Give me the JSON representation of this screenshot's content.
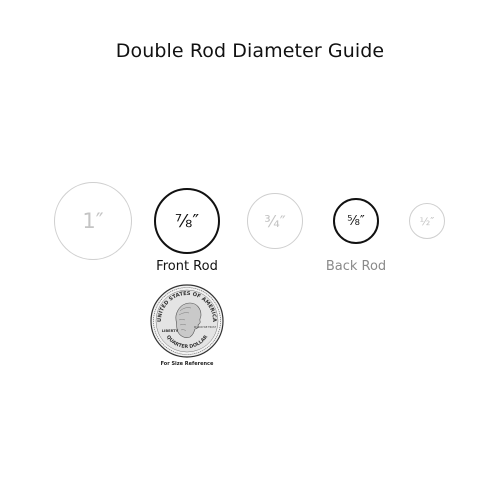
{
  "title": "Double Rod Diameter Guide",
  "rods": [
    {
      "size": "1″",
      "diameter_in": 1.0,
      "highlighted": false
    },
    {
      "size": "⅞″",
      "diameter_in": 0.875,
      "highlighted": true
    },
    {
      "size": "¾″",
      "diameter_in": 0.75,
      "highlighted": false
    },
    {
      "size": "⅝″",
      "diameter_in": 0.625,
      "highlighted": true
    },
    {
      "size": "½″",
      "diameter_in": 0.5,
      "highlighted": false
    }
  ],
  "labels": {
    "front_rod": "Front Rod",
    "back_rod": "Back Rod"
  },
  "coin": {
    "top_text": "UNITED STATES OF AMERICA",
    "bottom_text": "QUARTER DOLLAR",
    "left_text": "LIBERTY",
    "motto": "IN GOD WE TRUST",
    "caption": "For Size Reference"
  },
  "colors": {
    "highlight": "#111111",
    "muted": "#c4c4c4",
    "back_label": "#8a8a8a"
  }
}
